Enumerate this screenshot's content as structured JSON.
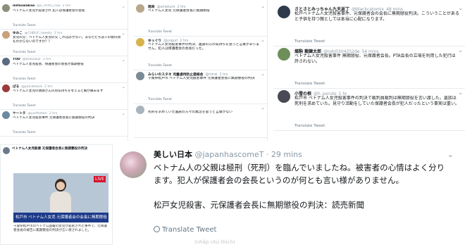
{
  "left_panel": {
    "tweets": [
      {
        "name": "mitsuwakaa",
        "handle": "@o_mitsu_nao",
        "time": "2 hrs",
        "text": "ベトナム人女児が殺害され 犯人は保護者会の会長",
        "translate": "Translate Tweet"
      },
      {
        "name": "ゆみこ",
        "handle": "@CHBUC_tweety",
        "time": "2 hrs",
        "text": "女児の父：ベトナム人女児の父 これは許せない。あなたたちは人の親の顔もわからないのですか？？",
        "translate": "Translate Tweet"
      },
      {
        "name": "TOD",
        "handle": "@todocbuk",
        "time": "2 hrs",
        "text": "ベトナム人女児殺害、保護者会の会長が無期懲役",
        "translate": "Translate Tweet"
      },
      {
        "name": "ぱる",
        "handle": "@palcatwork",
        "time": "2 hrs",
        "text": "ベトナム人女児の親御さんのお気持ちを考えると胸が痛みます",
        "translate": "Translate Tweet"
      },
      {
        "name": "ヤートタ",
        "handle": "@yarttatom",
        "time": "2 hrs",
        "text": "ベトナム人女児殺害事件 元保護者会長に無期懲役の判決",
        "translate": "Translate Tweet"
      }
    ]
  },
  "middle_panel": {
    "tweets": [
      {
        "name": "雨来",
        "handle": "@amekuro",
        "time": "2 hrs",
        "text": "ベトナム人女児 元保護者会長に無期懲役 ",
        "translate": "Translate Tweet"
      },
      {
        "name": "ゆぅぐり",
        "handle": "@yuguri",
        "time": "2 hrs",
        "text": "ベトナム人女児殺害事件の判決、遺族の方の気持ちを思うと言葉がありません。犯人は保護者会の会長だった。",
        "translate": "Translate Tweet"
      },
      {
        "name": "みらいのスタネ 児童虐待防止連絡会",
        "handle": "@mirai",
        "time": "2 hrs",
        "text": "千葉県松戸市 ベトナム人女児殺害事件 元保護者会長に無期懲役の判決",
        "translate": "Translate Tweet"
      },
      {
        "name": "",
        "handle": "",
        "time": "",
        "text": "死刑を求めていた遺族の方々の無念を思うと言葉がない",
        "translate": ""
      }
    ]
  },
  "right_panel": {
    "tweets": [
      {
        "name": "さとさとみっちゃん九天返丁",
        "handle": "@blackcatomix",
        "time": "48 mins",
        "text": "松戸ベトナム人女児殺害事件、元保護者会の会長に無期懲役判決。こういうことがあると子供を持つ親としては本当に心配になります。",
        "translate": "Translate Tweet"
      },
      {
        "name": "燦駒 龍錬太郎",
        "handle": "@roki0304252de",
        "time": "54 mins",
        "text": "ベトナム人女児殺害事件 無期懲役、元保護者会長。PTA会長の立場を利用した犯行は許されない。",
        "translate": "Translate Tweet"
      },
      {
        "name": "小雪の根",
        "handle": "@h_poruto",
        "time": "1 hr",
        "text": "松戸市 ベトナム人女児殺害事件の判決で裁判員裁判は無期懲役を言い渡した。遺族は死刑を求めていた。見守り活動をしていた保護者会長が犯人だったという事実は重い。",
        "translate": "Translate Tweet"
      }
    ]
  },
  "news_panel": {
    "live_badge": "LIVE",
    "headline_top": "ベトナム人女児殺害 元保護者会長に無期懲役の判決",
    "caption": "松戸市 ベトナム人女児 元保護者会の会長に無期懲役",
    "sub_text": "千葉県松戸市のベトナム国籍の女児が殺害された事件で、元保護者会長の被告に無期懲役の判決が言い渡されました。",
    "more": "Translate Tweet"
  },
  "main_tweet": {
    "name": "美しい日本",
    "handle": "@japanhascomeT",
    "time": "29 mins",
    "text": "ベトナム人の父親は極刑（死刑）を臨んでいましたね。被害者の心情はよく分ります。犯人が保護者会の会長というのが何とも言い様がありません。",
    "link": "松戸女児殺害、元保護者会長に無期懲役の判決：読売新聞",
    "translate": "Translate Tweet",
    "footer": "(nhấp chú thích)"
  }
}
